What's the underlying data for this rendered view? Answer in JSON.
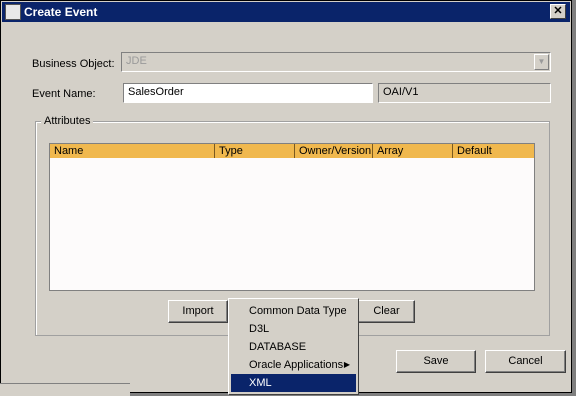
{
  "window": {
    "title": "Create Event",
    "close_glyph": "✕"
  },
  "form": {
    "business_object_label": "Business Object:",
    "business_object_value": "JDE",
    "event_name_label": "Event Name:",
    "event_name_value": "SalesOrder",
    "version_value": "OAI/V1"
  },
  "attributes": {
    "legend": "Attributes",
    "columns": [
      "Name",
      "Type",
      "Owner/Version",
      "Array",
      "Default"
    ],
    "rows": []
  },
  "buttons": {
    "import": "Import",
    "clear": "Clear",
    "save": "Save",
    "cancel": "Cancel"
  },
  "add_menu": {
    "items": [
      {
        "label": "Common Data Type",
        "submenu": false,
        "selected": false
      },
      {
        "label": "D3L",
        "submenu": false,
        "selected": false
      },
      {
        "label": "DATABASE",
        "submenu": false,
        "selected": false
      },
      {
        "label": "Oracle Applications",
        "submenu": true,
        "selected": false
      },
      {
        "label": "XML",
        "submenu": false,
        "selected": true
      }
    ]
  },
  "colors": {
    "titlebar": "#0a246a",
    "table_header": "#f0b84e",
    "selection": "#0a246a",
    "dialog_bg": "#d4d0c8"
  }
}
